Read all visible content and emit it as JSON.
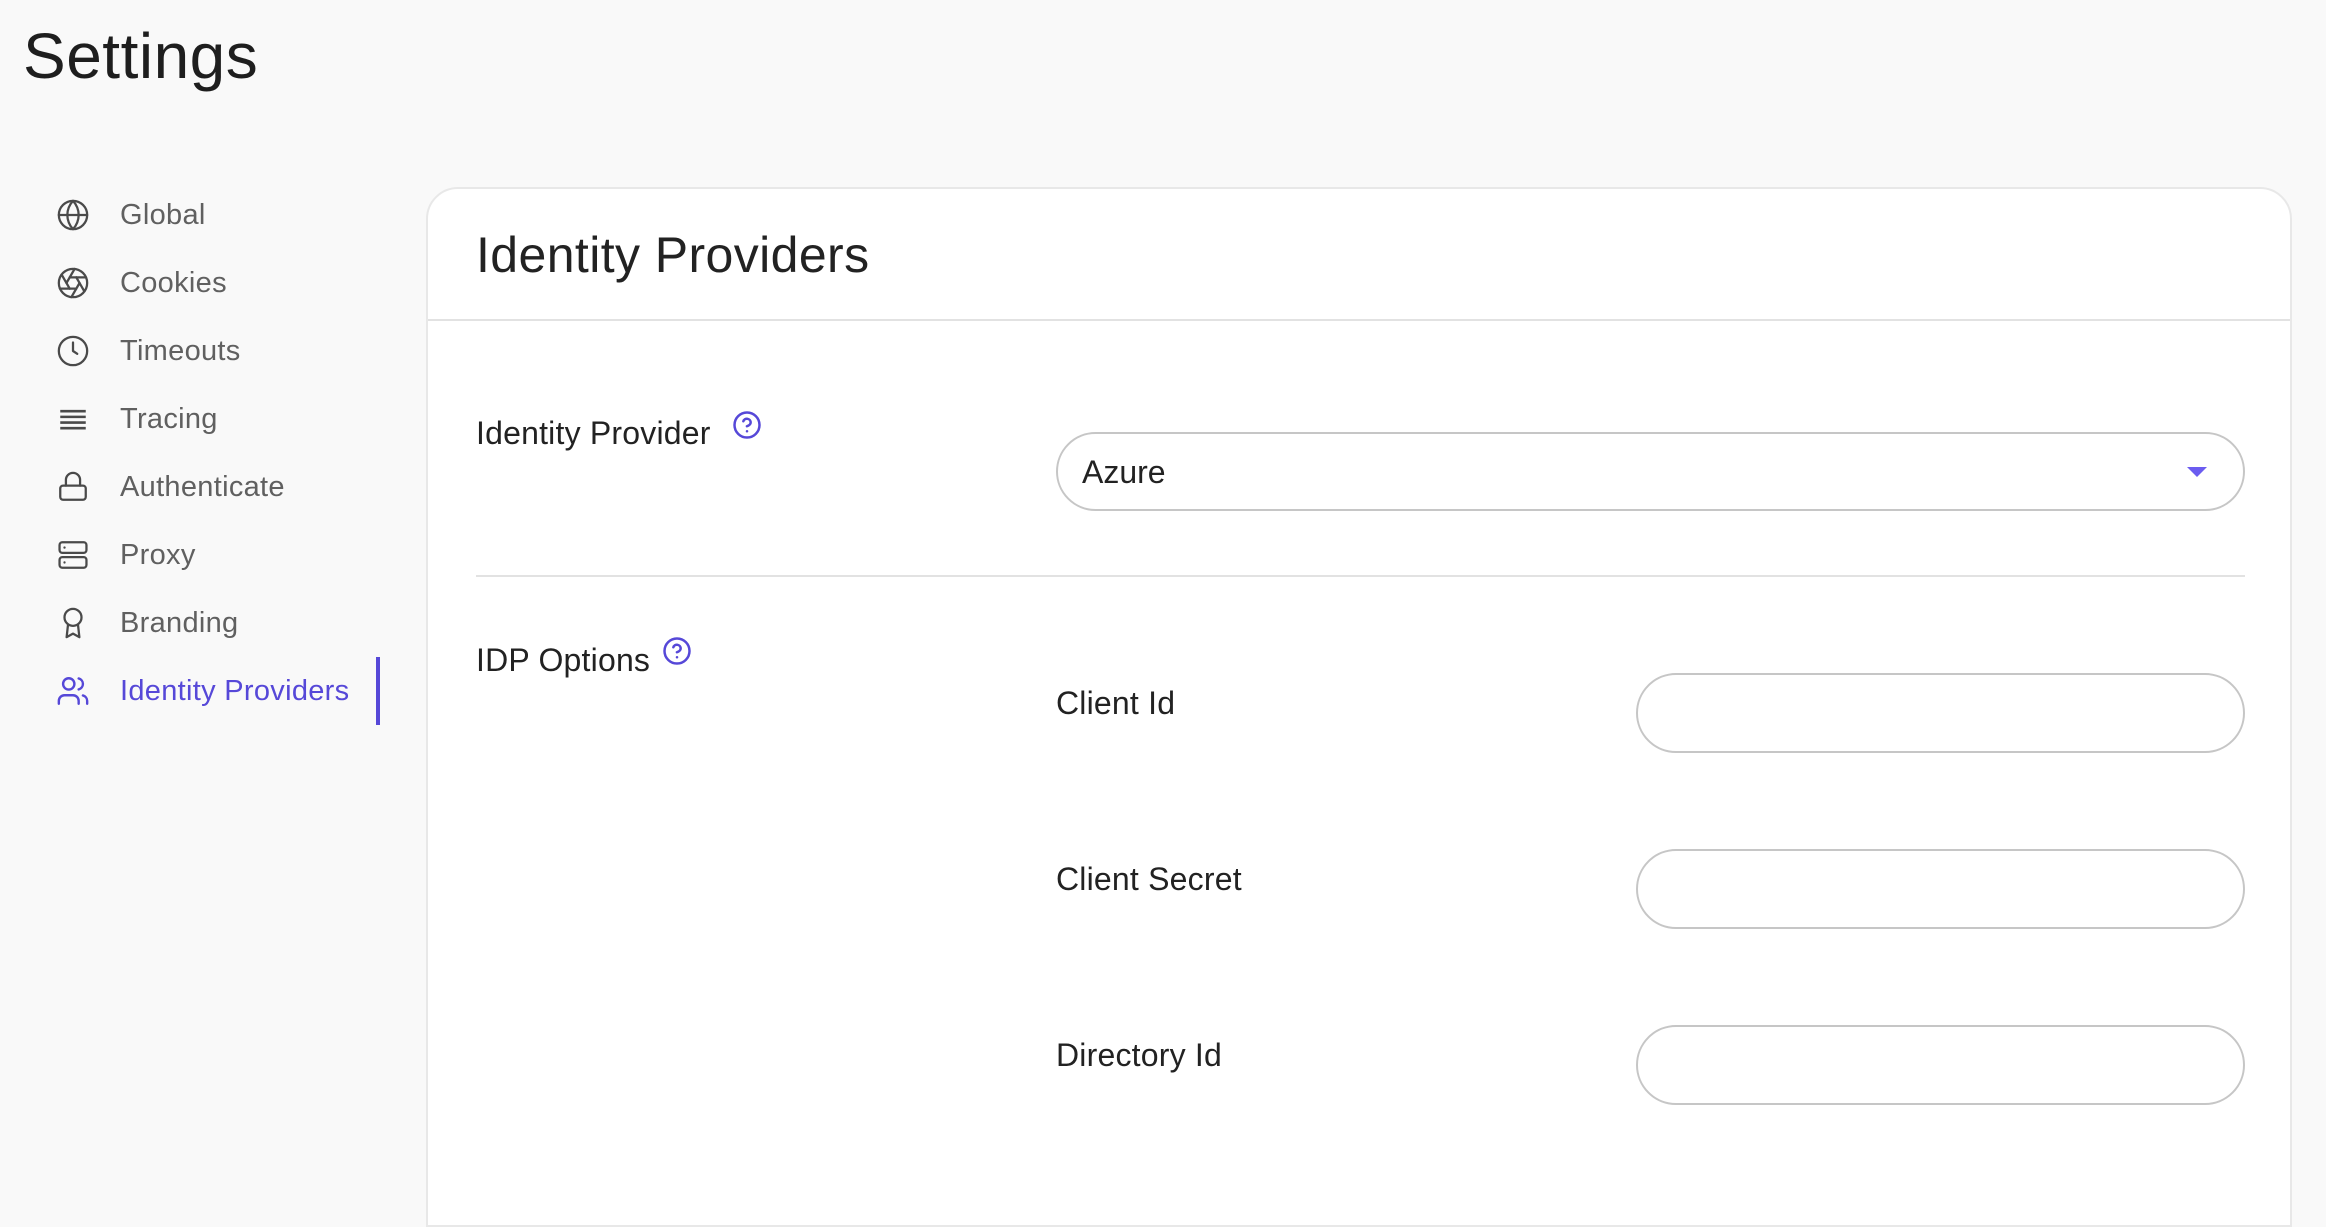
{
  "page": {
    "title": "Settings"
  },
  "accent_color": "#5648d8",
  "sidebar": {
    "active_index": 7,
    "items": [
      {
        "label": "Global",
        "icon": "globe-icon"
      },
      {
        "label": "Cookies",
        "icon": "aperture-icon"
      },
      {
        "label": "Timeouts",
        "icon": "clock-icon"
      },
      {
        "label": "Tracing",
        "icon": "lines-icon"
      },
      {
        "label": "Authenticate",
        "icon": "lock-icon"
      },
      {
        "label": "Proxy",
        "icon": "server-icon"
      },
      {
        "label": "Branding",
        "icon": "award-icon"
      },
      {
        "label": "Identity Providers",
        "icon": "users-icon"
      }
    ]
  },
  "card": {
    "title": "Identity Providers",
    "identity_provider": {
      "label": "Identity Provider",
      "help_icon": "help-circle-icon",
      "selected_value": "Azure"
    },
    "idp_options": {
      "label": "IDP Options",
      "help_icon": "help-circle-icon",
      "fields": [
        {
          "label": "Client Id",
          "value": "",
          "placeholder": ""
        },
        {
          "label": "Client Secret",
          "value": "",
          "placeholder": ""
        },
        {
          "label": "Directory Id",
          "value": "",
          "placeholder": ""
        }
      ]
    }
  }
}
